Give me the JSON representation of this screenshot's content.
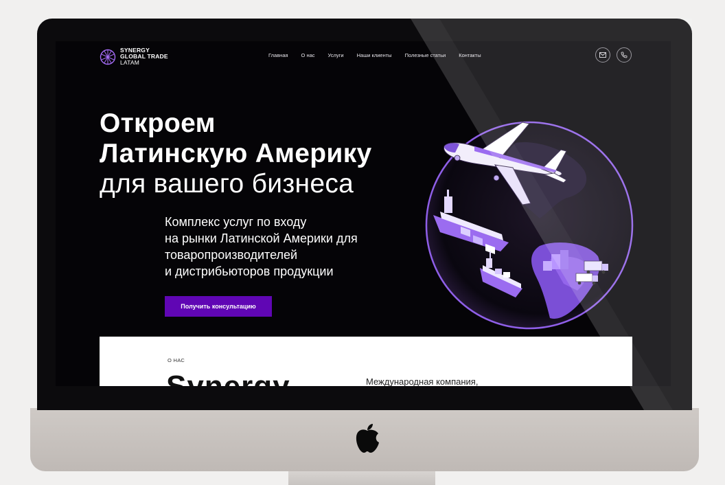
{
  "site": {
    "logo": {
      "line1": "SYNERGY",
      "line2": "GLOBAL TRADE",
      "line3": "LATAM"
    },
    "nav": [
      "Главная",
      "О нас",
      "Услуги",
      "Наши клиенты",
      "Полезные статьи",
      "Контакты"
    ],
    "header_icons": [
      "mail-icon",
      "phone-icon"
    ],
    "hero": {
      "title_line1": "Откроем",
      "title_line2": "Латинскую Америку",
      "title_line3": "для вашего бизнеса",
      "subtitle_lines": [
        "Комплекс услуг по входу",
        "на рынки Латинской Америки для",
        "товаропроизводителей",
        "и дистрибьюторов продукции"
      ],
      "cta_label": "Получить консультацию"
    },
    "about": {
      "label": "О НАС",
      "big_heading": "Synergy",
      "description": "Международная компания,"
    }
  },
  "colors": {
    "accent": "#6006b4",
    "screen_bg": "#050407",
    "globe_purple": "#9b6cf0"
  }
}
